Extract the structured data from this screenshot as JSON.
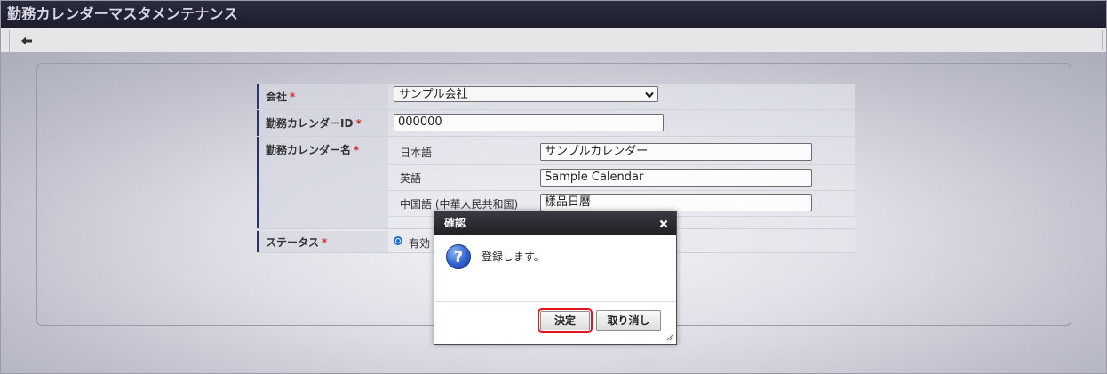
{
  "window": {
    "title": "勤務カレンダーマスタメンテナンス"
  },
  "toolbar": {
    "back_icon": "arrow-left-icon"
  },
  "form": {
    "required_mark": "*",
    "company": {
      "label": "会社",
      "value": "サンプル会社"
    },
    "calendar_id": {
      "label": "勤務カレンダーID",
      "value": "000000"
    },
    "calendar_name": {
      "label": "勤務カレンダー名",
      "languages": [
        {
          "label": "日本語",
          "value": "サンプルカレンダー"
        },
        {
          "label": "英語",
          "value": "Sample Calendar"
        },
        {
          "label": "中国語 (中華人民共和国)",
          "value": "樣品日曆"
        }
      ]
    },
    "status": {
      "label": "ステータス",
      "option_label": "有効"
    }
  },
  "dialog": {
    "title": "確認",
    "close_icon": "close-icon",
    "message_icon": "question-icon",
    "message": "登録します。",
    "ok_label": "決定",
    "cancel_label": "取り消し"
  },
  "colors": {
    "title_bar": "#1c1d2c",
    "label_accent": "#2b3465",
    "required": "#d03030",
    "focus_outline": "#e0161c"
  }
}
